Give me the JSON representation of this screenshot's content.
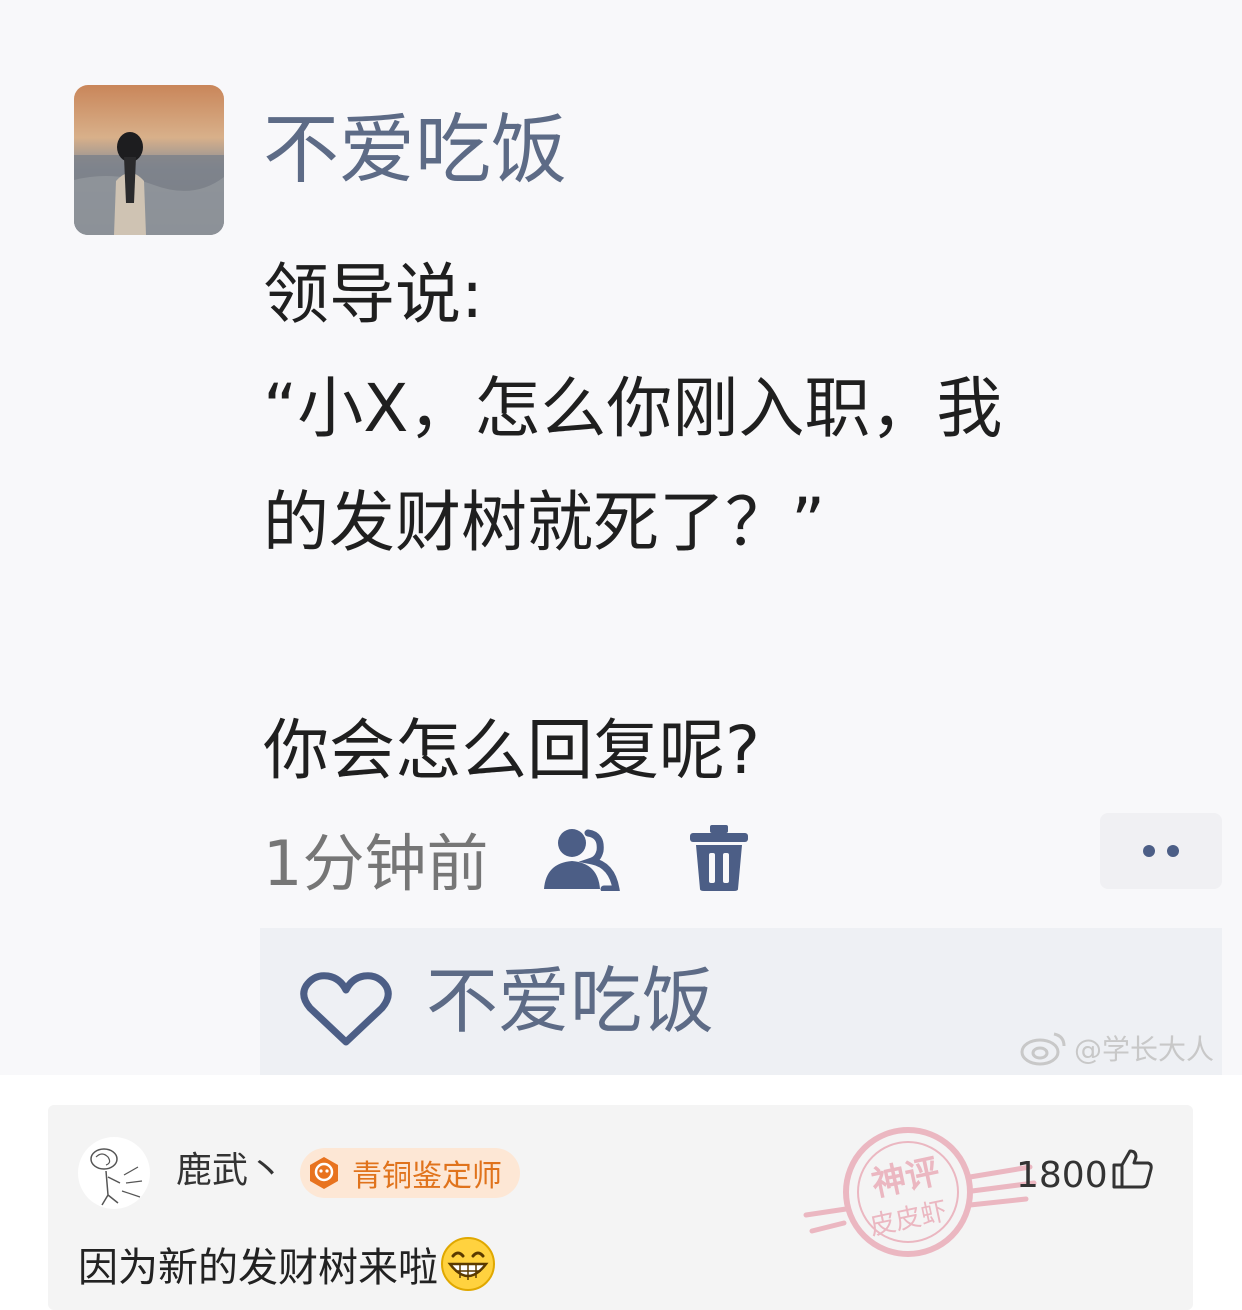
{
  "post": {
    "author_name": "不爱吃饭",
    "lines": [
      "领导说:",
      "“小X，怎么你刚入职，我",
      "的发财树就死了？”",
      "",
      "你会怎么回复呢?"
    ],
    "timestamp": "1分钟前",
    "icons": [
      "avatar-photo",
      "friends-icon",
      "trash-icon",
      "more-icon"
    ],
    "likes": {
      "icon": "heart-icon",
      "liker_name": "不爱吃饭"
    },
    "watermark": "@学长大人"
  },
  "comment": {
    "author_name": "鹿武丶",
    "rank_label": "青铜鉴定师",
    "stamp_text_top": "神评",
    "stamp_text_bottom": "皮皮虾",
    "like_count": "1800",
    "text": "因为新的发财树来啦",
    "emoji": "grinning-face-icon"
  },
  "colors": {
    "name_blue": "#5d6b86",
    "icon_blue": "#4c5e86",
    "badge_orange": "#e0731c",
    "stamp_red": "#e8a3b0"
  }
}
